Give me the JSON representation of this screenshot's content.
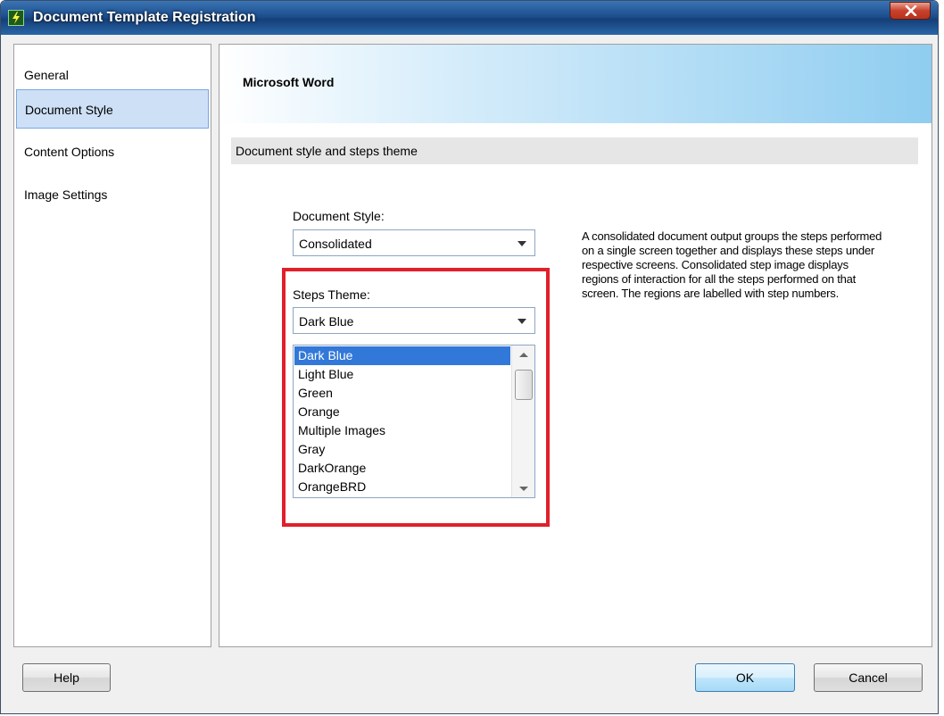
{
  "window": {
    "title": "Document Template Registration",
    "close_glyph": "X"
  },
  "sidebar": {
    "items": [
      {
        "label": "General",
        "selected": false
      },
      {
        "label": "Document Style",
        "selected": true
      },
      {
        "label": "Content Options",
        "selected": false
      },
      {
        "label": "Image Settings",
        "selected": false
      }
    ]
  },
  "main": {
    "banner_title": "Microsoft Word",
    "section_title": "Document style and steps theme",
    "document_style": {
      "label": "Document Style:",
      "value": "Consolidated"
    },
    "steps_theme": {
      "label": "Steps Theme:",
      "value": "Dark Blue",
      "options": [
        "Dark Blue",
        "Light Blue",
        "Green",
        "Orange",
        "Multiple Images",
        "Gray",
        "DarkOrange",
        "OrangeBRD"
      ],
      "selected_index": 0
    },
    "description": "A consolidated document output groups the steps performed on a single screen together and displays these steps under respective screens. Consolidated step image displays regions of interaction for all the steps performed on that screen. The regions are labelled with step numbers."
  },
  "footer": {
    "help_label": "Help",
    "ok_label": "OK",
    "cancel_label": "Cancel"
  },
  "colors": {
    "highlight_box": "#e0202a",
    "selected_list_item": "#3178d8",
    "selected_nav_item": "#cde0f6"
  }
}
